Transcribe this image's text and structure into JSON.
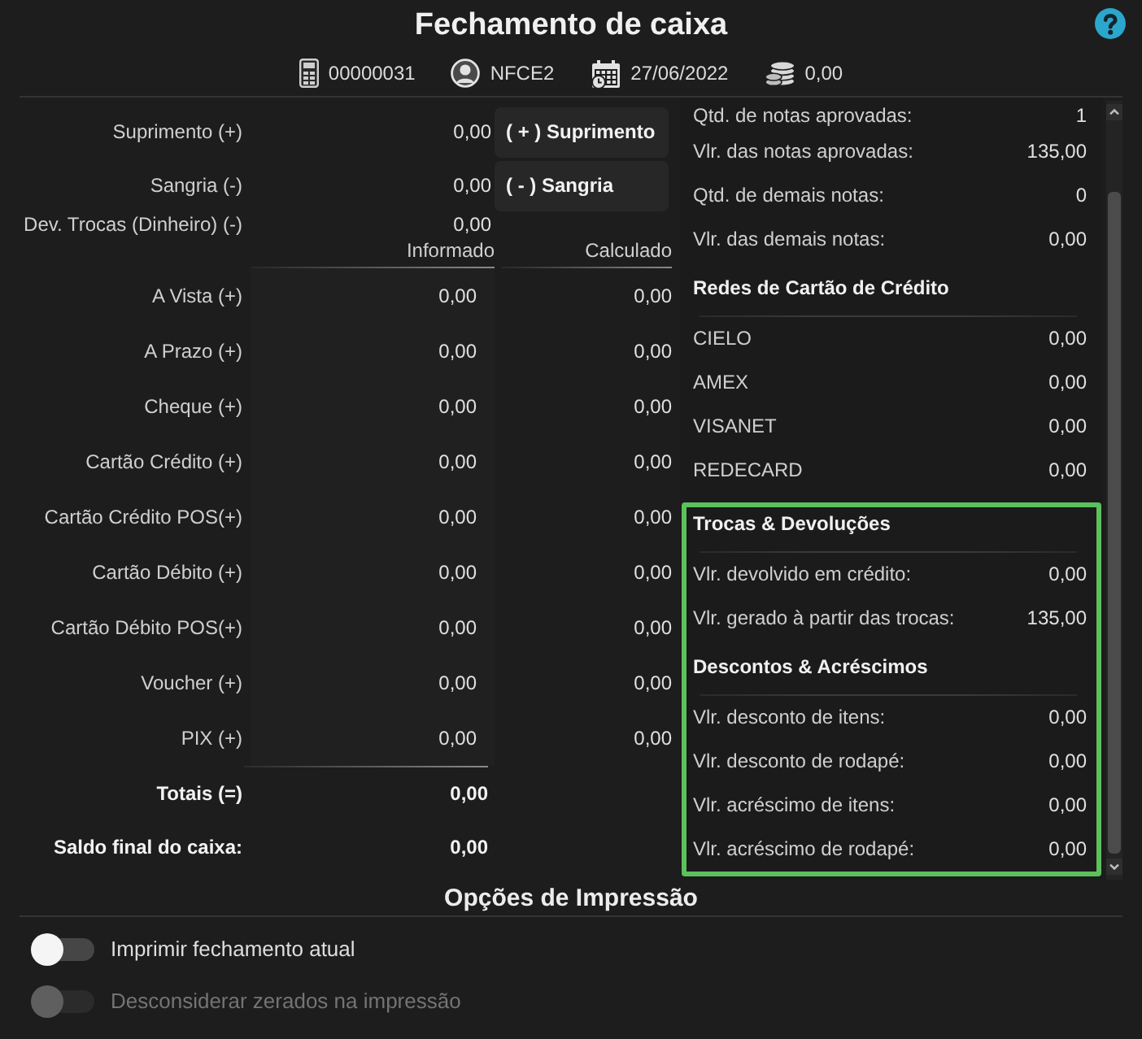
{
  "window": {
    "title": "Fechamento de caixa"
  },
  "info_bar": [
    {
      "kind": "terminal",
      "text": "00000031"
    },
    {
      "kind": "operator",
      "text": "NFCE2"
    },
    {
      "kind": "date",
      "text": "27/06/2022"
    },
    {
      "kind": "balance",
      "text": "0,00"
    }
  ],
  "cash_movements": [
    {
      "label": "Suprimento (+)",
      "value": "0,00",
      "button": "( + ) Suprimento"
    },
    {
      "label": "Sangria (-)",
      "value": "0,00",
      "button": "( - ) Sangria"
    },
    {
      "label": "Dev. Trocas (Dinheiro) (-)",
      "value": "0,00"
    }
  ],
  "payments": {
    "columns": [
      "Informado",
      "Calculado"
    ],
    "rows": [
      {
        "label": "A Vista (+)",
        "informed": "0,00",
        "calculated": "0,00"
      },
      {
        "label": "A Prazo (+)",
        "informed": "0,00",
        "calculated": "0,00"
      },
      {
        "label": "Cheque (+)",
        "informed": "0,00",
        "calculated": "0,00"
      },
      {
        "label": "Cartão Crédito (+)",
        "informed": "0,00",
        "calculated": "0,00"
      },
      {
        "label": "Cartão Crédito POS(+)",
        "informed": "0,00",
        "calculated": "0,00"
      },
      {
        "label": "Cartão Débito (+)",
        "informed": "0,00",
        "calculated": "0,00"
      },
      {
        "label": "Cartão Débito POS(+)",
        "informed": "0,00",
        "calculated": "0,00"
      },
      {
        "label": "Voucher (+)",
        "informed": "0,00",
        "calculated": "0,00"
      },
      {
        "label": "PIX (+)",
        "informed": "0,00",
        "calculated": "0,00"
      }
    ]
  },
  "totals": [
    {
      "label": "Totais (=)",
      "value": "0,00"
    },
    {
      "label": "Saldo final do caixa:",
      "value": "0,00"
    }
  ],
  "summary": {
    "blocks": [
      {
        "highlighted": false,
        "sections": [
          {
            "rows": [
              {
                "label": "Qtd. de notas aprovadas:",
                "value": "1"
              },
              {
                "label": "Vlr. das notas aprovadas:",
                "value": "135,00"
              },
              {
                "label": "Qtd. de demais notas:",
                "value": "0"
              },
              {
                "label": "Vlr. das demais notas:",
                "value": "0,00"
              }
            ]
          },
          {
            "title": "Redes de Cartão de Crédito",
            "rows": [
              {
                "label": "CIELO",
                "value": "0,00"
              },
              {
                "label": "AMEX",
                "value": "0,00"
              },
              {
                "label": "VISANET",
                "value": "0,00"
              },
              {
                "label": "REDECARD",
                "value": "0,00"
              }
            ]
          }
        ]
      },
      {
        "highlighted": true,
        "sections": [
          {
            "title": "Trocas & Devoluções",
            "rows": [
              {
                "label": "Vlr. devolvido em crédito:",
                "value": "0,00"
              },
              {
                "label": "Vlr. gerado à partir das trocas:",
                "value": "135,00"
              }
            ]
          },
          {
            "title": "Descontos & Acréscimos",
            "rows": [
              {
                "label": "Vlr. desconto de itens:",
                "value": "0,00"
              },
              {
                "label": "Vlr. desconto de rodapé:",
                "value": "0,00"
              },
              {
                "label": "Vlr. acréscimo de itens:",
                "value": "0,00"
              },
              {
                "label": "Vlr. acréscimo de rodapé:",
                "value": "0,00"
              }
            ]
          }
        ]
      }
    ]
  },
  "print_options": {
    "title": "Opções de Impressão",
    "options": [
      {
        "label": "Imprimir fechamento atual",
        "on": false,
        "disabled": false
      },
      {
        "label": "Desconsiderar zerados na impressão",
        "on": false,
        "disabled": true
      }
    ]
  }
}
